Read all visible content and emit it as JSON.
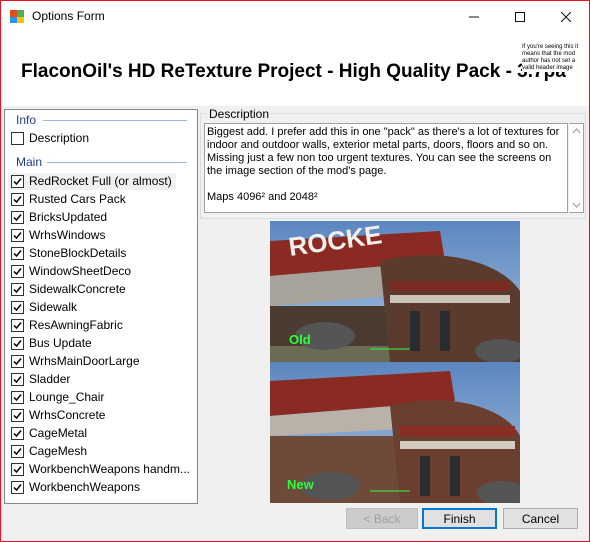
{
  "window": {
    "title": "Options Form",
    "minimize": "—",
    "maximize": "☐",
    "close": "✕"
  },
  "banner": {
    "title": "FlaconOil's HD ReTexture Project - High Quality Pack - 3.7pa",
    "note": "If you're seeing this it means that the mod author has not set a valid header image"
  },
  "groups": {
    "info": {
      "label": "Info",
      "items": [
        {
          "label": "Description",
          "checked": false
        }
      ]
    },
    "main": {
      "label": "Main",
      "items": [
        {
          "label": "RedRocket Full (or almost)",
          "checked": true,
          "selected": true
        },
        {
          "label": "Rusted Cars Pack",
          "checked": true
        },
        {
          "label": "BricksUpdated",
          "checked": true
        },
        {
          "label": "WrhsWindows",
          "checked": true
        },
        {
          "label": "StoneBlockDetails",
          "checked": true
        },
        {
          "label": "WindowSheetDeco",
          "checked": true
        },
        {
          "label": "SidewalkConcrete",
          "checked": true
        },
        {
          "label": "Sidewalk",
          "checked": true
        },
        {
          "label": "ResAwningFabric",
          "checked": true
        },
        {
          "label": "Bus Update",
          "checked": true
        },
        {
          "label": "WrhsMainDoorLarge",
          "checked": true
        },
        {
          "label": "Sladder",
          "checked": true
        },
        {
          "label": "Lounge_Chair",
          "checked": true
        },
        {
          "label": "WrhsConcrete",
          "checked": true
        },
        {
          "label": "CageMetal",
          "checked": true
        },
        {
          "label": "CageMesh",
          "checked": true
        },
        {
          "label": "WorkbenchWeapons handm...",
          "checked": true
        },
        {
          "label": "WorkbenchWeapons",
          "checked": true
        }
      ]
    }
  },
  "description": {
    "legend": "Description",
    "text": "Biggest add. I prefer add this in one \"pack\" as there's a lot of textures for indoor and outdoor walls, exterior metal parts, doors, floors and so on. Missing just a few non too urgent textures. You can see the screens on the image section of the mod's page.\n\nMaps 4096² and 2048²"
  },
  "preview": {
    "sign_text": "ROCKE",
    "label_old": "Old",
    "label_new": "New"
  },
  "buttons": {
    "back": "< Back",
    "finish": "Finish",
    "cancel": "Cancel"
  }
}
